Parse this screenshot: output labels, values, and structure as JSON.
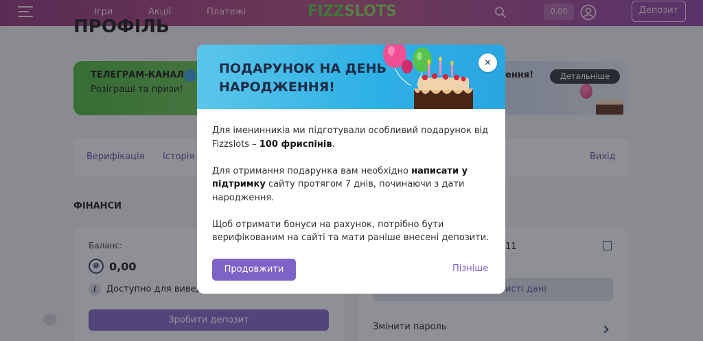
{
  "header": {
    "nav": [
      "Ігри",
      "Акції",
      "Платежі"
    ],
    "logo_part1": "FIZZ",
    "logo_part2": "SLOTS",
    "balance": "0.00",
    "deposit_label": "Депозит"
  },
  "page": {
    "title": "ПРОФІЛЬ",
    "telegram": {
      "title": "ТЕЛЕГРАМ-КАНАЛ",
      "subtitle": "Розіграші та призи!"
    },
    "birthday_tail": "ення!",
    "details_label": "Детальніше",
    "tabs": [
      "Верифікація",
      "Історія",
      "Вихід"
    ],
    "finance_heading": "ФІНАНСИ",
    "balance_label": "Баланс:",
    "currency_symbol": "₴",
    "balance_value": "0,00",
    "available_text": "Доступно для виведення",
    "make_deposit_label": "Зробити депозит",
    "right_number_tail": "11",
    "personal_data_tail": "исті дані",
    "change_password_label": "Змінити пароль"
  },
  "modal": {
    "title": "ПОДАРУНОК НА ДЕНЬ НАРОДЖЕННЯ!",
    "close_label": "×",
    "p1_a": "Для іменинників ми підготували особливий подарунок від Fizzslots – ",
    "p1_bold": "100 фриспінів",
    "p1_b": ".",
    "p2_a": "Для отримання подарунка вам необхідно ",
    "p2_bold": "написати у підтримку",
    "p2_b": " сайту протягом 7 днів, починаючи з дати народження.",
    "p3": "Щоб отримати бонуси на рахунок, потрібно бути верифікованим на сайті та мати раніше внесені депозити.",
    "continue_label": "Продовжити",
    "later_label": "Пізніше"
  },
  "colors": {
    "accent": "#7f62c8",
    "header_gradient_start": "#8e2f7a",
    "modal_header": "#2fb1e6"
  }
}
